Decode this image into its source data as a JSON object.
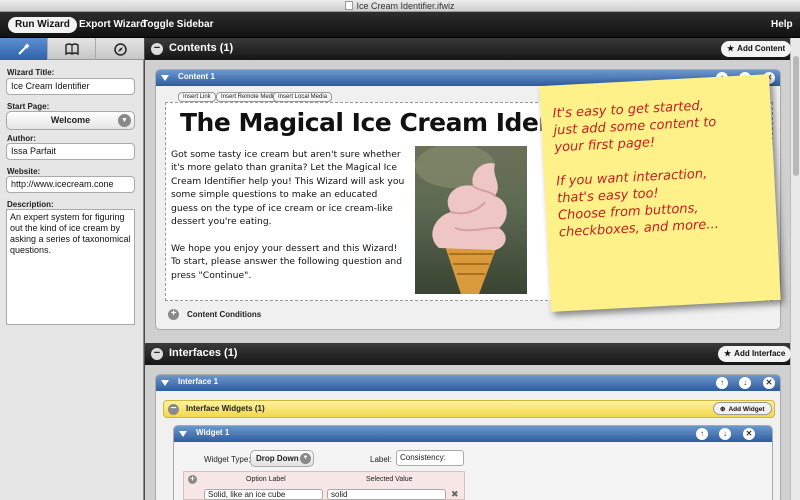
{
  "window": {
    "title": "Ice Cream Identifier.ifwiz"
  },
  "toolbar": {
    "run": "Run Wizard",
    "export": "Export Wizard",
    "toggle": "Toggle Sidebar",
    "help": "Help"
  },
  "sidebar": {
    "tabs": [
      "wand-icon",
      "book-icon",
      "compass-icon"
    ],
    "wizard_title_label": "Wizard Title:",
    "wizard_title_value": "Ice Cream Identifier",
    "start_page_label": "Start Page:",
    "start_page_value": "Welcome",
    "author_label": "Author:",
    "author_value": "Issa Parfait",
    "website_label": "Website:",
    "website_value": "http://www.icecream.cone",
    "description_label": "Description:",
    "description_value": "An expert system for figuring out the kind of ice cream by asking a series of taxonomical questions."
  },
  "contents": {
    "header": "Contents (1)",
    "add_button": "Add Content",
    "item_title": "Content 1",
    "mini_tabs": [
      "Insert Link",
      "Insert Remote Media",
      "Insert Local Media"
    ],
    "page_title": "The Magical Ice Cream Identifier!",
    "paragraph1": "Got some tasty ice cream but aren't sure whether it's more gelato than granita? Let the Magical Ice Cream Identifier help you! This Wizard will ask you some simple questions to make an educated guess on the type of ice cream or ice cream-like dessert you're eating.",
    "paragraph2": "We hope you enjoy your dessert and this Wizard! To start, please answer the following question and press \"Continue\".",
    "conditions": "Content Conditions"
  },
  "sticky_note": {
    "line1": "It's easy to get started,",
    "line2": "just add some content to",
    "line3": "your first page!",
    "line4": "If you want interaction,",
    "line5": "that's easy too!",
    "line6": "Choose from buttons,",
    "line7": "checkboxes, and more..."
  },
  "interfaces": {
    "header": "Interfaces (1)",
    "add_button": "Add Interface",
    "item_title": "Interface 1",
    "widgets_header": "Interface Widgets (1)",
    "add_widget": "Add Widget",
    "widget_title": "Widget 1",
    "widget_type_label": "Widget Type:",
    "widget_type_value": "Drop Down",
    "label_label": "Label:",
    "label_value": "Consistency:",
    "option_label_header": "Option Label",
    "selected_value_header": "Selected Value",
    "option1_label": "Solid, like an ice cube",
    "option1_value": "solid"
  },
  "colors": {
    "accent_blue": "#2e5d9e",
    "sticky_yellow": "#fff18a",
    "sticky_text": "#c21f1f",
    "widget_yellow": "#f1d84a"
  }
}
